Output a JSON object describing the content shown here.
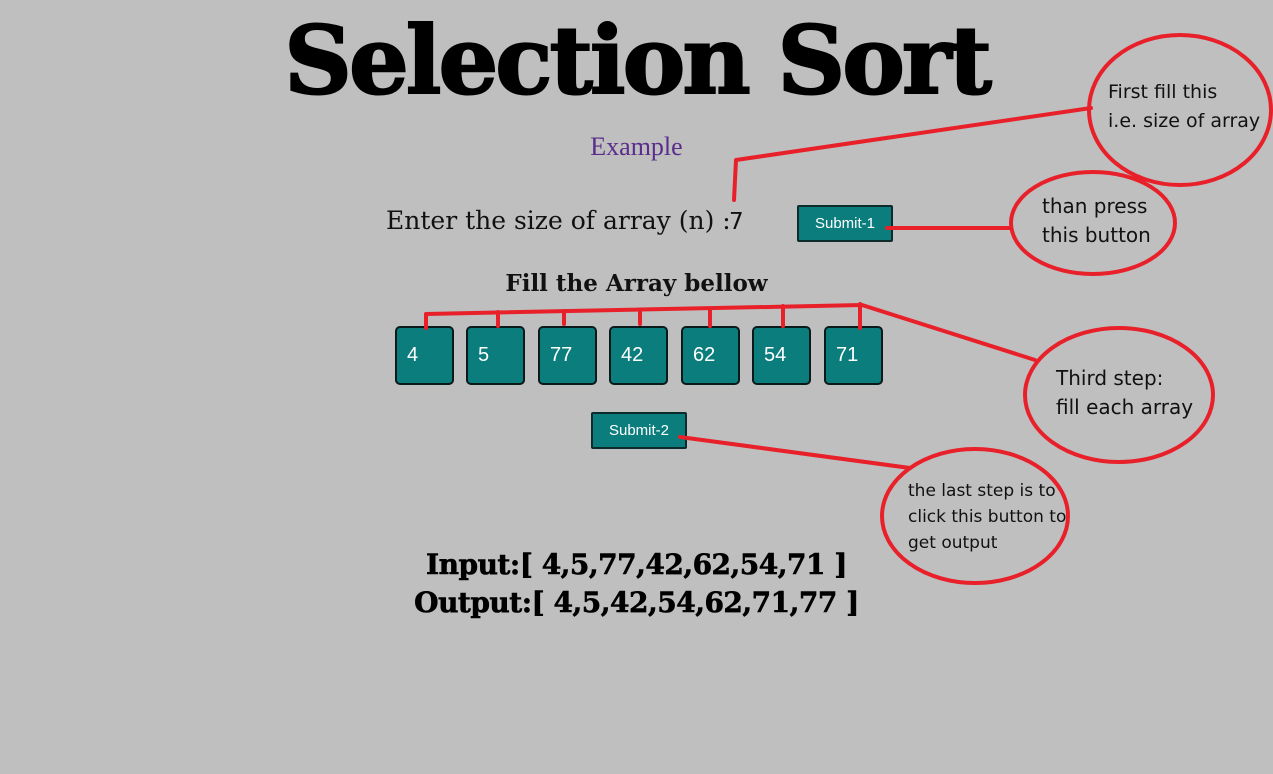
{
  "header": {
    "title": "Selection Sort",
    "example_link": "Example"
  },
  "size_form": {
    "label": "Enter the size of array (n) :",
    "value": "7",
    "submit_label": "Submit-1"
  },
  "array_form": {
    "heading": "Fill the Array bellow",
    "values": [
      "4",
      "5",
      "77",
      "42",
      "62",
      "54",
      "71"
    ],
    "submit_label": "Submit-2"
  },
  "results": {
    "input_line": "Input:[ 4,5,77,42,62,54,71 ]",
    "output_line": "Output:[ 4,5,42,54,62,71,77 ]"
  },
  "annotations": {
    "note1": "First fill this\ni.e. size of array",
    "note2": "than press\nthis button",
    "note3": "Third step:\nfill each array",
    "note4": "the last step is to\nclick this button to\nget output",
    "color": "#e8202a"
  },
  "colors": {
    "background": "#bfbfbf",
    "button": "#0b7d7d",
    "link": "#5a2d8c"
  }
}
